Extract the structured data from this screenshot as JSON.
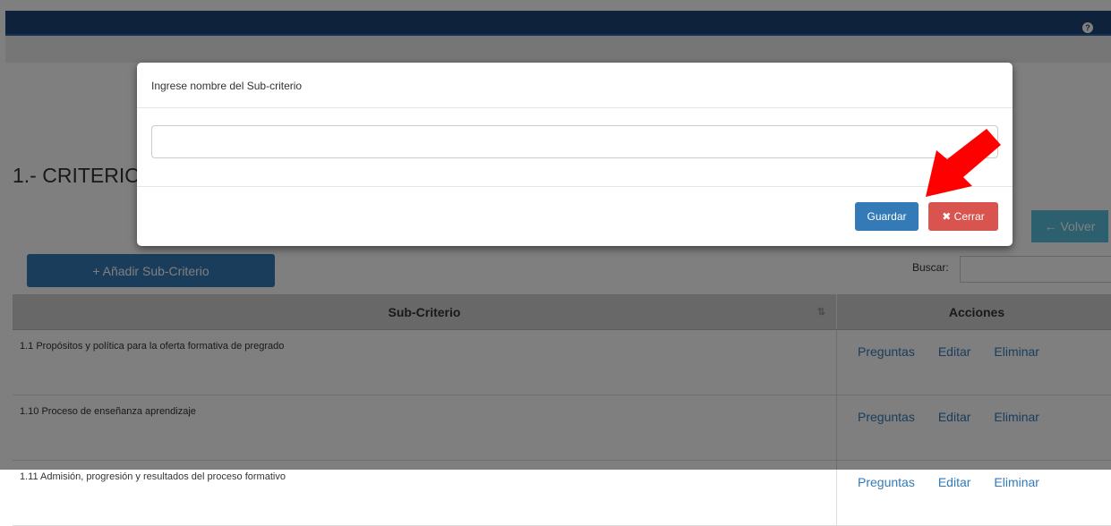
{
  "header": {
    "help_icon": "?"
  },
  "page": {
    "title": "1.- CRITERIO",
    "volver_label": "← Volver",
    "add_label": "+ Añadir Sub-Criterio",
    "search_label": "Buscar:"
  },
  "table": {
    "columns": [
      "Sub-Criterio",
      "Acciones"
    ],
    "rows": [
      {
        "name": "1.1 Propósitos y política para la oferta formativa de pregrado",
        "a1": "Preguntas",
        "a2": "Editar",
        "a3": "Eliminar"
      },
      {
        "name": "1.10 Proceso de enseñanza aprendizaje",
        "a1": "Preguntas",
        "a2": "Editar",
        "a3": "Eliminar"
      },
      {
        "name": "1.11 Admisión, progresión y resultados del proceso formativo",
        "a1": "Preguntas",
        "a2": "Editar",
        "a3": "Eliminar"
      }
    ]
  },
  "modal": {
    "title": "Ingrese nombre del Sub-criterio",
    "input_value": "",
    "save_label": "Guardar",
    "close_label": "✖ Cerrar"
  },
  "colors": {
    "header": "#1e4476",
    "primary": "#337ab7",
    "danger": "#d9534f",
    "info": "#5bc0de",
    "arrow": "#ff0000"
  }
}
